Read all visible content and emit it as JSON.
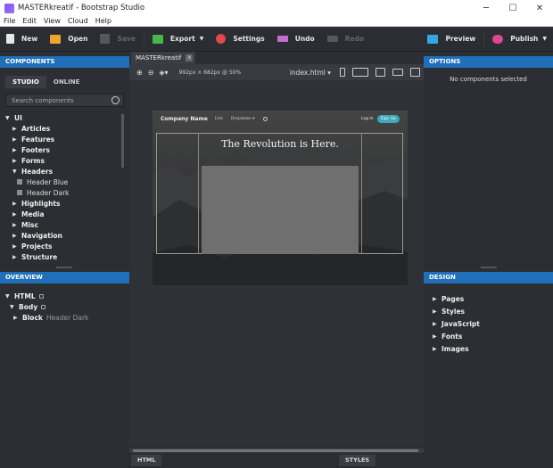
{
  "window": {
    "title": "MASTERkreatif - Bootstrap Studio",
    "controls": [
      "─",
      "☐",
      "✕"
    ]
  },
  "menu": [
    "File",
    "Edit",
    "View",
    "Cloud",
    "Help"
  ],
  "toolbar": {
    "new": "New",
    "open": "Open",
    "save": "Save",
    "export": "Export",
    "settings": "Settings",
    "undo": "Undo",
    "redo": "Redo",
    "preview": "Preview",
    "publish": "Publish",
    "colors": {
      "new": "#e8e8e8",
      "open": "#f1a531",
      "save": "#6b6e73",
      "export": "#46b749",
      "settings": "#e0484a",
      "undo": "#c96bd0",
      "redo": "#6b6e73",
      "preview": "#35a7e0",
      "publish": "#d94a8f"
    }
  },
  "components": {
    "header": "COMPONENTS",
    "tabs": [
      "STUDIO",
      "ONLINE"
    ],
    "search_placeholder": "Search components",
    "root": "UI",
    "items": [
      {
        "label": "Articles",
        "expanded": false
      },
      {
        "label": "Features",
        "expanded": false
      },
      {
        "label": "Footers",
        "expanded": false
      },
      {
        "label": "Forms",
        "expanded": false
      },
      {
        "label": "Headers",
        "expanded": true
      },
      {
        "label": "Header Blue",
        "child": true
      },
      {
        "label": "Header Dark",
        "child": true
      },
      {
        "label": "Highlights",
        "expanded": false
      },
      {
        "label": "Media",
        "expanded": false
      },
      {
        "label": "Misc",
        "expanded": false
      },
      {
        "label": "Navigation",
        "expanded": false
      },
      {
        "label": "Projects",
        "expanded": false
      },
      {
        "label": "Structure",
        "expanded": false
      }
    ]
  },
  "overview": {
    "header": "OVERVIEW",
    "html": "HTML",
    "body": "Body",
    "block": "Block",
    "block_name": "Header Dark"
  },
  "options": {
    "header": "OPTIONS",
    "empty": "No components selected"
  },
  "design": {
    "header": "DESIGN",
    "items": [
      "Pages",
      "Styles",
      "JavaScript",
      "Fonts",
      "Images"
    ]
  },
  "editor": {
    "tab": "MASTERkreatif",
    "tab_close": "x",
    "dims": "992px × 682px @ 50%",
    "file": "index.html",
    "bottom_tabs": [
      "HTML",
      "STYLES"
    ]
  },
  "preview": {
    "brand": "Company Name",
    "link": "Link",
    "dropdown": "Dropdown",
    "login": "Log In",
    "signup": "Sign Up",
    "heading": "The Revolution is Here."
  }
}
